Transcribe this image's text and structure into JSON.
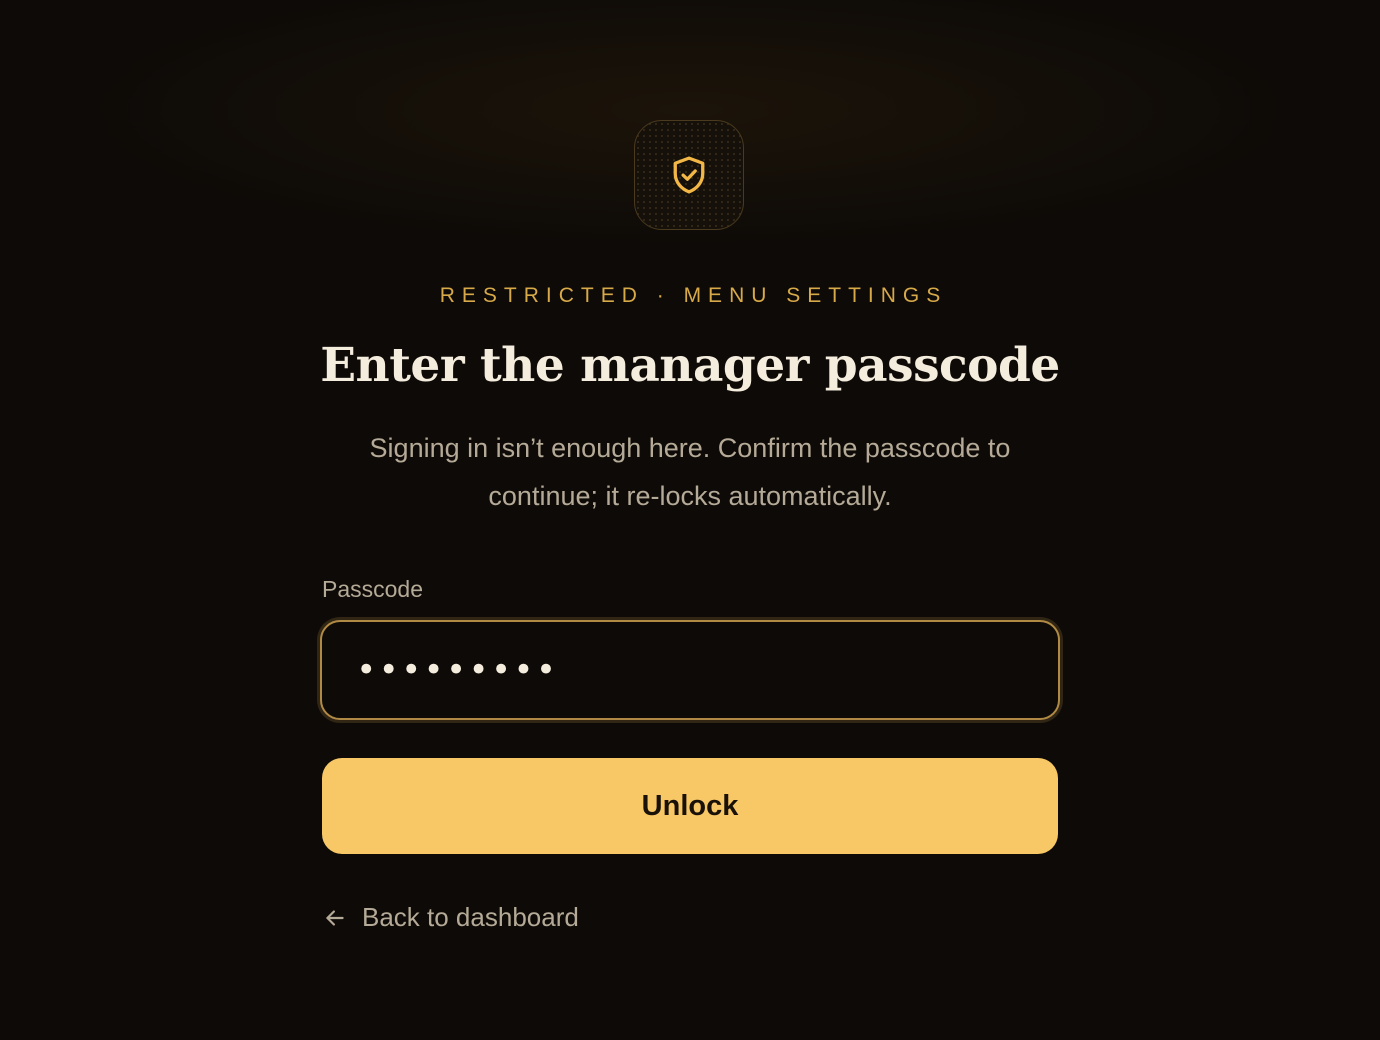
{
  "badge": {
    "icon": "shield-check-icon"
  },
  "header": {
    "eyebrow": "RESTRICTED · MENU SETTINGS",
    "title": "Enter the manager passcode",
    "subtitle": "Signing in isn’t enough here. Confirm the passcode to continue; it re-locks automatically."
  },
  "form": {
    "passcode_label": "Passcode",
    "passcode_value": "•••••••••",
    "submit_label": "Unlock"
  },
  "footer": {
    "back_label": "Back to dashboard",
    "back_icon": "arrow-left-icon"
  },
  "colors": {
    "background": "#0d0a07",
    "accent": "#f8c766",
    "eyebrow": "#d8a949",
    "title": "#f4ecdc",
    "muted": "#b5aa97",
    "input_border": "#b08a45"
  }
}
